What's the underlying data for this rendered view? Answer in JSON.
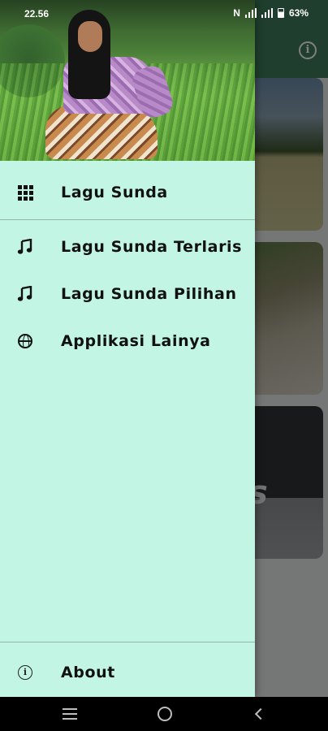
{
  "status_bar": {
    "time": "22.56",
    "network_badge": "N",
    "battery": "63%",
    "icons": [
      "nfc-icon",
      "signal-icon",
      "signal-icon",
      "battery-icon"
    ]
  },
  "background_app": {
    "toolbar_icon": "info-icon",
    "card_3_text": "s"
  },
  "drawer": {
    "header_image": "Woman in batik blouse sitting in a rice field",
    "menu": [
      {
        "label": "Lagu Sunda",
        "icon": "grid-icon"
      },
      {
        "label": "Lagu Sunda Terlaris",
        "icon": "music-note-icon"
      },
      {
        "label": "Lagu Sunda Pilihan",
        "icon": "music-note-icon"
      },
      {
        "label": "Applikasi Lainya",
        "icon": "globe-icon"
      }
    ],
    "about": {
      "label": "About",
      "icon": "info-icon"
    }
  },
  "nav_bar": {
    "buttons": [
      "recents-icon",
      "home-icon",
      "back-icon"
    ]
  },
  "colors": {
    "drawer_background": "#c2f5e3",
    "toolbar": "#3f7d5a",
    "nav_bar": "#000000"
  }
}
